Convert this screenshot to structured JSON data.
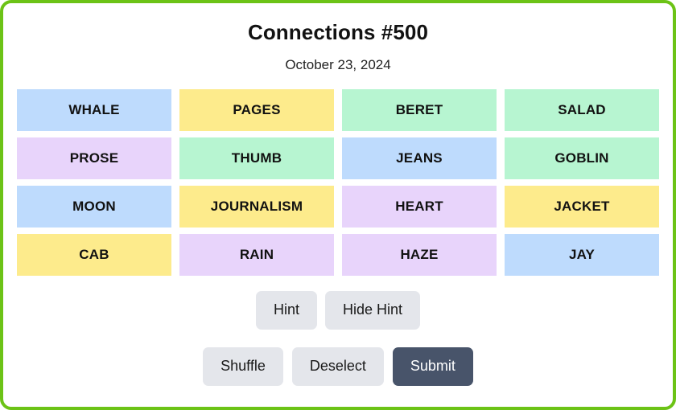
{
  "header": {
    "title": "Connections #500",
    "date": "October 23, 2024"
  },
  "colors": {
    "frame_border": "#6cc316",
    "tile_blue": "#bedbfd",
    "tile_yellow": "#fdeb8c",
    "tile_green": "#b7f5d1",
    "tile_purple": "#e8d4fb",
    "button_secondary_bg": "#e4e6eb",
    "button_primary_bg": "#48546a",
    "button_primary_text": "#ffffff",
    "page_background": "#ffffff"
  },
  "grid": {
    "rows": 4,
    "columns": 4,
    "tiles": [
      {
        "word": "WHALE",
        "color": "blue"
      },
      {
        "word": "PAGES",
        "color": "yellow"
      },
      {
        "word": "BERET",
        "color": "green"
      },
      {
        "word": "SALAD",
        "color": "green"
      },
      {
        "word": "PROSE",
        "color": "purple"
      },
      {
        "word": "THUMB",
        "color": "green"
      },
      {
        "word": "JEANS",
        "color": "blue"
      },
      {
        "word": "GOBLIN",
        "color": "green"
      },
      {
        "word": "MOON",
        "color": "blue"
      },
      {
        "word": "JOURNALISM",
        "color": "yellow"
      },
      {
        "word": "HEART",
        "color": "purple"
      },
      {
        "word": "JACKET",
        "color": "yellow"
      },
      {
        "word": "CAB",
        "color": "yellow"
      },
      {
        "word": "RAIN",
        "color": "purple"
      },
      {
        "word": "HAZE",
        "color": "purple"
      },
      {
        "word": "JAY",
        "color": "blue"
      }
    ]
  },
  "hint_controls": {
    "hint_label": "Hint",
    "hide_hint_label": "Hide Hint"
  },
  "action_controls": {
    "shuffle_label": "Shuffle",
    "deselect_label": "Deselect",
    "submit_label": "Submit"
  }
}
